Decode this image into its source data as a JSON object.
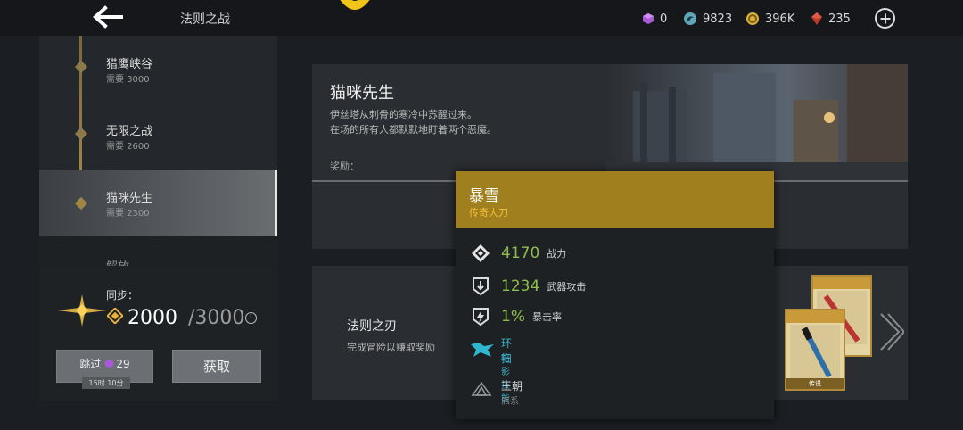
{
  "header": {
    "title": "法则之战",
    "back_icon": "back-arrow-icon",
    "resources": [
      {
        "icon": "purple-gem-icon",
        "value": "0",
        "color": "#a85ad8"
      },
      {
        "icon": "spirit-orb-icon",
        "value": "9823",
        "color": "#5fa6b8"
      },
      {
        "icon": "gold-coin-icon",
        "value": "396K",
        "color": "#d8b23c"
      },
      {
        "icon": "ruby-icon",
        "value": "235",
        "color": "#c0392b"
      }
    ],
    "add_icon": "plus-circle-icon"
  },
  "sidebar": {
    "chapters": [
      {
        "name": "猎鹰峡谷",
        "requirement": "需要 3000",
        "state": "normal"
      },
      {
        "name": "无限之战",
        "requirement": "需要 2600",
        "state": "normal"
      },
      {
        "name": "猫咪先生",
        "requirement": "需要 2300",
        "state": "active"
      },
      {
        "name": "解放",
        "requirement": "",
        "state": "faded"
      }
    ],
    "sync": {
      "label": "同步：",
      "current": "2000",
      "max": "/3000"
    },
    "skip_button": {
      "label": "跳过",
      "cost": "29",
      "timer": "15时 10分"
    },
    "get_button": {
      "label": "获取"
    }
  },
  "quest": {
    "title": "猫咪先生",
    "description_line1": "伊丝塔从刺骨的寒冷中苏醒过来。",
    "description_line2": "在场的所有人都默默地盯着两个恶魔。",
    "reward_label": "奖励："
  },
  "mission": {
    "title": "法则之刃",
    "description": "完成冒险以赚取奖励",
    "card_tag": "传说"
  },
  "tooltip": {
    "name": "暴雪",
    "rarity": "传奇大刀",
    "stats": [
      {
        "icon": "power-icon",
        "value": "4170",
        "label": "战力"
      },
      {
        "icon": "weapon-attack-icon",
        "value": "1234",
        "label": "武器攻击"
      },
      {
        "icon": "crit-rate-icon",
        "value": "1%",
        "label": "暴击率"
      }
    ],
    "skill": {
      "icon": "shadow-skill-icon",
      "name": "环扫",
      "type": "暗影技能"
    },
    "faction": {
      "icon": "dynasty-icon",
      "name": "王朝",
      "type": "派系"
    },
    "colors": {
      "header": "#a0801e",
      "rarity": "#f3c23b",
      "stat": "#8fbe4c",
      "skill": "#3ab0c9"
    }
  }
}
